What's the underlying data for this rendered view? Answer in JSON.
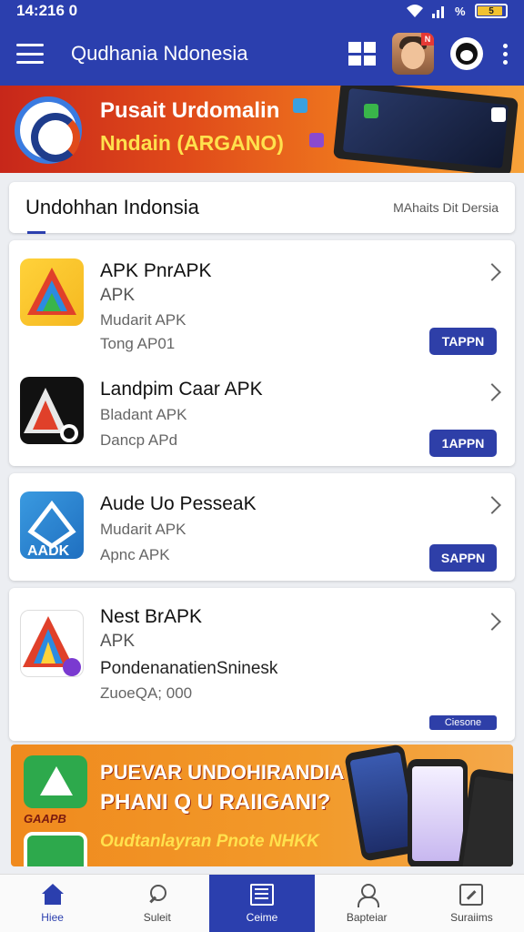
{
  "status_bar": {
    "time": "14:216 0",
    "battery_text": "5"
  },
  "app_bar": {
    "title": "Qudhania Ndonesia",
    "avatar_badge": "N"
  },
  "top_banner": {
    "line1": "Pusait Urdomalin",
    "line2": "Nndain (ARGANO)"
  },
  "section": {
    "title": "Undohhan Indonsia",
    "link": "MAhaits Dit Dersia"
  },
  "apps": [
    {
      "name": "APK PnrAPK",
      "line1": "APK",
      "line2": "Mudarit APK",
      "line3": "Tong AP01",
      "button": "TAPPN"
    },
    {
      "name": "Landpim Caar APK",
      "line1": "Bladant APK",
      "line2": "Dancp APd",
      "button": "1APPN"
    },
    {
      "name": "Aude Uo PesseaK",
      "line1": "Mudarit APK",
      "line2": "Apnc APK",
      "button": "SAPPN"
    },
    {
      "name": "Nest BrAPK",
      "line1": "APK",
      "line2": "PondenanatienSninesk",
      "line3": "ZuoeQA; 000",
      "button": "Ciesone"
    }
  ],
  "bottom_banner": {
    "logo_label": "GAAPB",
    "line1": "PUEVAR UNDOHIRANDIA",
    "line2": "PHANI Q U RAIIGANI?",
    "line3": "Oudtanlayran Pnote NHKK"
  },
  "bottom_nav": [
    {
      "label": "Hiee",
      "icon": "home-icon"
    },
    {
      "label": "Suleit",
      "icon": "search-icon"
    },
    {
      "label": "Ceime",
      "icon": "list-icon"
    },
    {
      "label": "Bapteiar",
      "icon": "user-icon"
    },
    {
      "label": "Suraiims",
      "icon": "edit-icon"
    }
  ],
  "colors": {
    "primary": "#2b3fae",
    "button": "#2e3fa8",
    "banner_red": "#c7271a",
    "banner_orange": "#f08a1e"
  }
}
